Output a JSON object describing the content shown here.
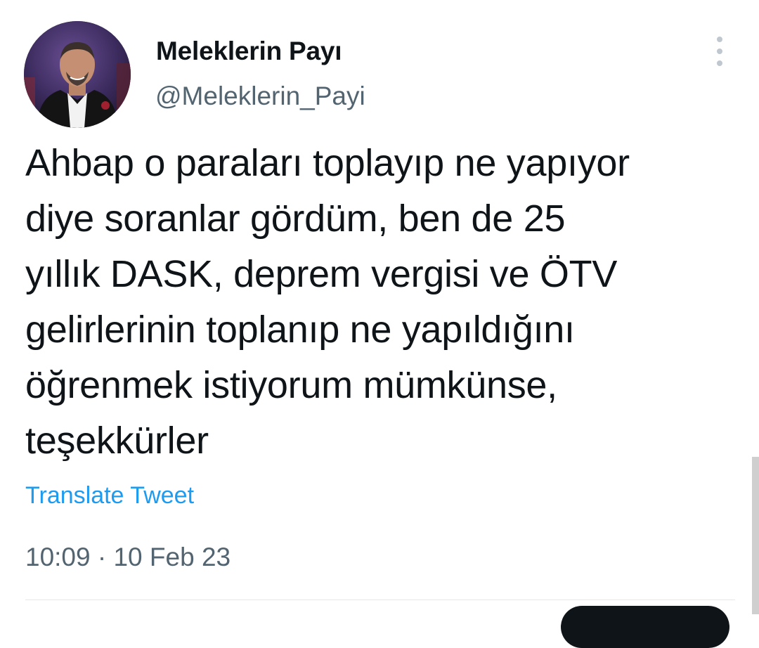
{
  "tweet": {
    "author": {
      "display_name": "Meleklerin Payı",
      "handle": "@Meleklerin_Payi"
    },
    "text": "Ahbap o paraları toplayıp ne yapıyor\ndiye soranlar gördüm, ben de 25\nyıllık DASK, deprem vergisi ve ÖTV\ngelirlerinin toplanıp ne yapıldığını\nöğrenmek istiyorum mümkünse,\nteşekkürler",
    "translate_label": "Translate Tweet",
    "timestamp": "10:09 · 10 Feb 23"
  },
  "icons": {
    "more": "more-vertical-icon"
  },
  "colors": {
    "text": "#0f1419",
    "secondary": "#536471",
    "link": "#1d9bf0"
  }
}
